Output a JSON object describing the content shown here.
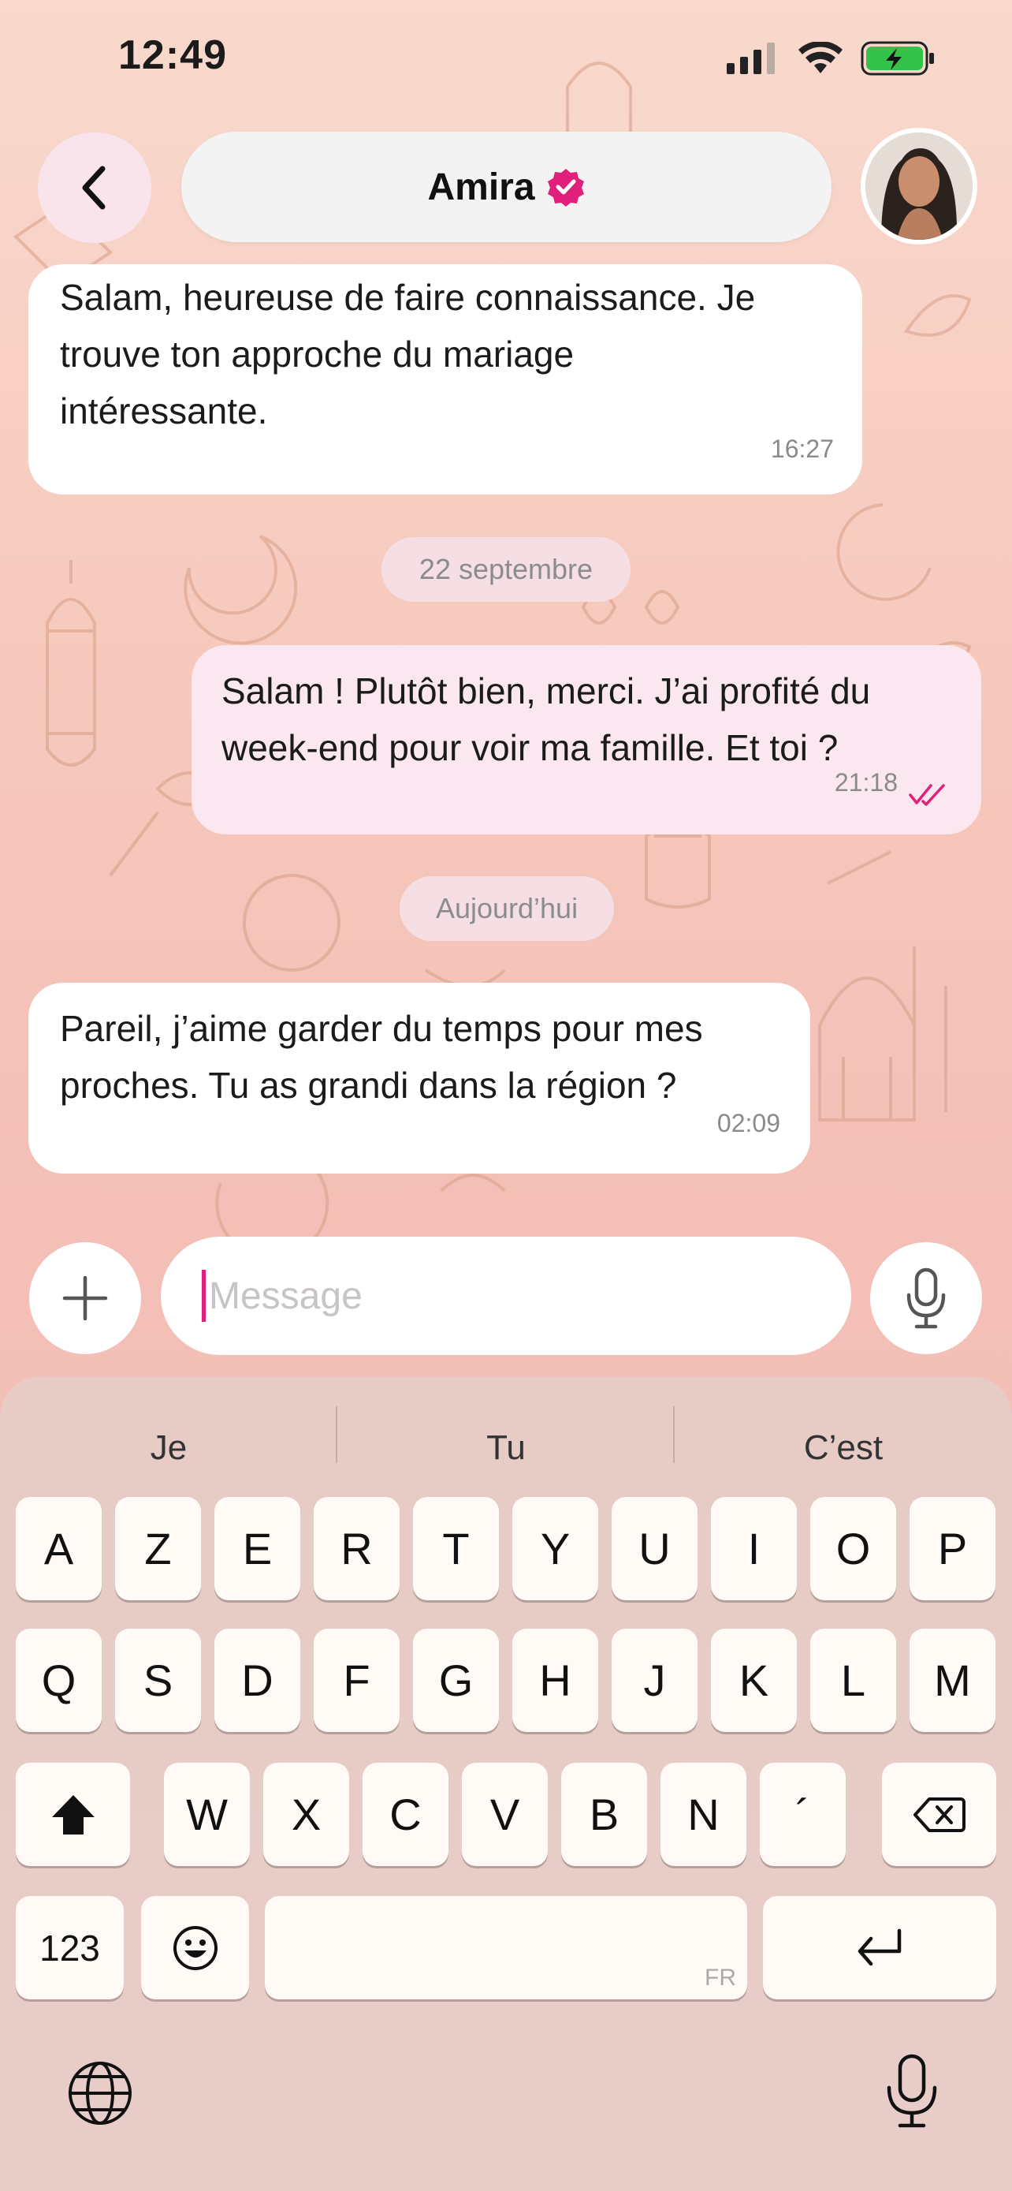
{
  "status_bar": {
    "time": "12:49"
  },
  "header": {
    "contact_name": "Amira",
    "verified": true
  },
  "messages": [
    {
      "direction": "in",
      "lines": [
        "Salam, heureuse de faire connaissance. Je",
        "trouve ton approche du mariage",
        "intéressante."
      ],
      "time": "16:27"
    },
    {
      "direction": "out",
      "lines": [
        "Salam ! Plutôt bien, merci. J’ai profité du",
        "week-end pour voir ma famille. Et toi ?"
      ],
      "time": "21:18",
      "read": true
    },
    {
      "direction": "in",
      "lines": [
        "Pareil, j’aime garder du temps pour mes",
        "proches. Tu as grandi dans la région ?"
      ],
      "time": "02:09"
    }
  ],
  "date_separators": [
    "22 septembre",
    "Aujourd’hui"
  ],
  "composer": {
    "placeholder": "Message"
  },
  "keyboard": {
    "suggestions": [
      "Je",
      "Tu",
      "C’est"
    ],
    "row1": [
      "A",
      "Z",
      "E",
      "R",
      "T",
      "Y",
      "U",
      "I",
      "O",
      "P"
    ],
    "row2": [
      "Q",
      "S",
      "D",
      "F",
      "G",
      "H",
      "J",
      "K",
      "L",
      "M"
    ],
    "row3": [
      "W",
      "X",
      "C",
      "V",
      "B",
      "N",
      "´"
    ],
    "numbers_key": "123",
    "space_lang": "FR"
  },
  "colors": {
    "accent": "#e0207a",
    "incoming_bubble": "#ffffff",
    "outgoing_bubble": "#fbe7ef"
  }
}
